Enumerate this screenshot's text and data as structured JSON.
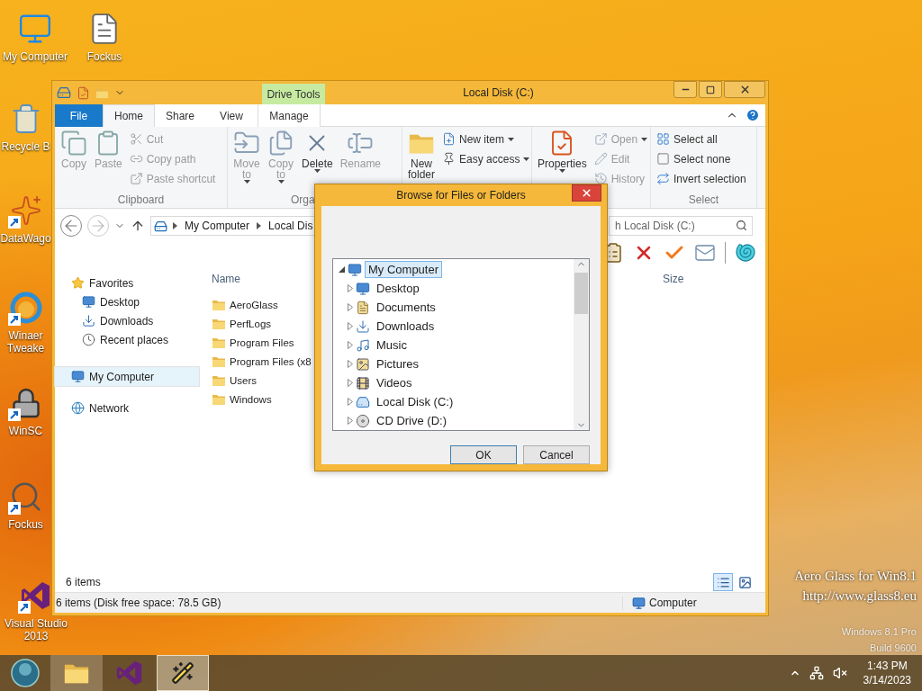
{
  "desktop_icons": [
    {
      "lines": [
        "My Computer"
      ],
      "shortcut": false
    },
    {
      "lines": [
        "Fockus"
      ],
      "shortcut": false
    },
    {
      "lines": [
        "Recycle B"
      ],
      "shortcut": false
    },
    {
      "lines": [
        "DataWago"
      ],
      "shortcut": true
    },
    {
      "lines": [
        "Winaer",
        "Tweake"
      ],
      "shortcut": true
    },
    {
      "lines": [
        "WinSC"
      ],
      "shortcut": true
    },
    {
      "lines": [
        "Fockus"
      ],
      "shortcut": true
    },
    {
      "lines": [
        "Visual Studio",
        "2013"
      ],
      "shortcut": true
    }
  ],
  "explorer": {
    "title": "Local Disk (C:)",
    "context_tab": "Drive Tools",
    "tabs": [
      {
        "label": "File",
        "kind": "file",
        "selected": false
      },
      {
        "label": "Home",
        "kind": "tab",
        "selected": true
      },
      {
        "label": "Share",
        "kind": "tab",
        "selected": false
      },
      {
        "label": "View",
        "kind": "tab",
        "selected": false
      },
      {
        "label": "Manage",
        "kind": "context",
        "selected": false
      }
    ],
    "ribbon_groups": [
      {
        "label": "Clipboard",
        "buttons": [
          {
            "label": "Copy",
            "kind": "large",
            "disabled": true,
            "menu": false
          },
          {
            "label": "Paste",
            "kind": "large",
            "disabled": true,
            "menu": false
          },
          {
            "label": "Cut",
            "kind": "small",
            "disabled": true,
            "menu": false
          },
          {
            "label": "Copy path",
            "kind": "small",
            "disabled": true,
            "menu": false
          },
          {
            "label": "Paste shortcut",
            "kind": "small",
            "disabled": true,
            "menu": false
          }
        ]
      },
      {
        "label": "Orga",
        "buttons": [
          {
            "label": "Move to",
            "kind": "large",
            "disabled": true,
            "menu": true
          },
          {
            "label": "Copy to",
            "kind": "large",
            "disabled": true,
            "menu": true
          },
          {
            "label": "Delete",
            "kind": "large",
            "disabled": false,
            "menu": true
          },
          {
            "label": "Rename",
            "kind": "large",
            "disabled": true,
            "menu": false
          }
        ]
      },
      {
        "buttons": [
          {
            "label": "New folder",
            "kind": "large",
            "disabled": false,
            "menu": false
          },
          {
            "label": "New item",
            "kind": "small",
            "disabled": false,
            "menu": true
          },
          {
            "label": "Easy access",
            "kind": "small",
            "disabled": false,
            "menu": true
          }
        ]
      },
      {
        "buttons": [
          {
            "label": "Properties",
            "kind": "large",
            "disabled": false,
            "menu": true
          },
          {
            "label": "Open",
            "kind": "small",
            "disabled": true,
            "menu": true
          },
          {
            "label": "Edit",
            "kind": "small",
            "disabled": true,
            "menu": false
          },
          {
            "label": "History",
            "kind": "small",
            "disabled": true,
            "menu": false
          }
        ]
      },
      {
        "label": "Select",
        "buttons": [
          {
            "label": "Select all",
            "kind": "small",
            "disabled": false,
            "menu": false
          },
          {
            "label": "Select none",
            "kind": "small",
            "disabled": false,
            "menu": false
          },
          {
            "label": "Invert selection",
            "kind": "small",
            "disabled": false,
            "menu": false
          }
        ]
      }
    ],
    "breadcrumb": [
      "My Computer",
      "Local Dis"
    ],
    "search": {
      "placeholder": "h Local Disk (C:)"
    },
    "nav_pane": [
      {
        "label": "Favorites",
        "selected": false,
        "children": [
          {
            "label": "Desktop",
            "selected": false
          },
          {
            "label": "Downloads",
            "selected": false
          },
          {
            "label": "Recent places",
            "selected": false
          }
        ]
      },
      {
        "label": "My Computer",
        "selected": true
      },
      {
        "label": "Network",
        "selected": false
      }
    ],
    "columns": [
      "Name",
      "Size"
    ],
    "files": [
      "AeroGlass",
      "PerfLogs",
      "Program Files",
      "Program Files (x8",
      "Users",
      "Windows"
    ],
    "item_count": "6 items",
    "views": [
      {
        "selected": true
      },
      {
        "selected": false
      }
    ],
    "status_bar": {
      "summary": "6 items (Disk free space: 78.5 GB)",
      "location": "Computer"
    }
  },
  "dialog": {
    "title": "Browse for Files or Folders",
    "tree": [
      {
        "label": "My Computer",
        "selected": true,
        "expanded": true,
        "children": [
          {
            "label": "Desktop",
            "selected": false,
            "expanded": false
          },
          {
            "label": "Documents",
            "selected": false,
            "expanded": false
          },
          {
            "label": "Downloads",
            "selected": false,
            "expanded": false
          },
          {
            "label": "Music",
            "selected": false,
            "expanded": false
          },
          {
            "label": "Pictures",
            "selected": false,
            "expanded": false
          },
          {
            "label": "Videos",
            "selected": false,
            "expanded": false
          },
          {
            "label": "Local Disk (C:)",
            "selected": false,
            "expanded": false
          },
          {
            "label": "CD Drive (D:)",
            "selected": false,
            "expanded": false
          }
        ]
      }
    ],
    "buttons": [
      {
        "label": "OK",
        "default": true
      },
      {
        "label": "Cancel",
        "default": false
      }
    ]
  },
  "watermark": {
    "lines": [
      "Aero Glass for Win8.1",
      "http://www.glass8.eu"
    ],
    "os_lines": [
      "Windows 8.1 Pro",
      "Build 9600"
    ]
  },
  "taskbar": {
    "items": [
      {
        "running": true,
        "selected": false
      },
      {
        "running": false,
        "selected": false
      },
      {
        "running": true,
        "selected": true
      }
    ],
    "time": "1:43 PM",
    "date": "3/14/2023"
  }
}
